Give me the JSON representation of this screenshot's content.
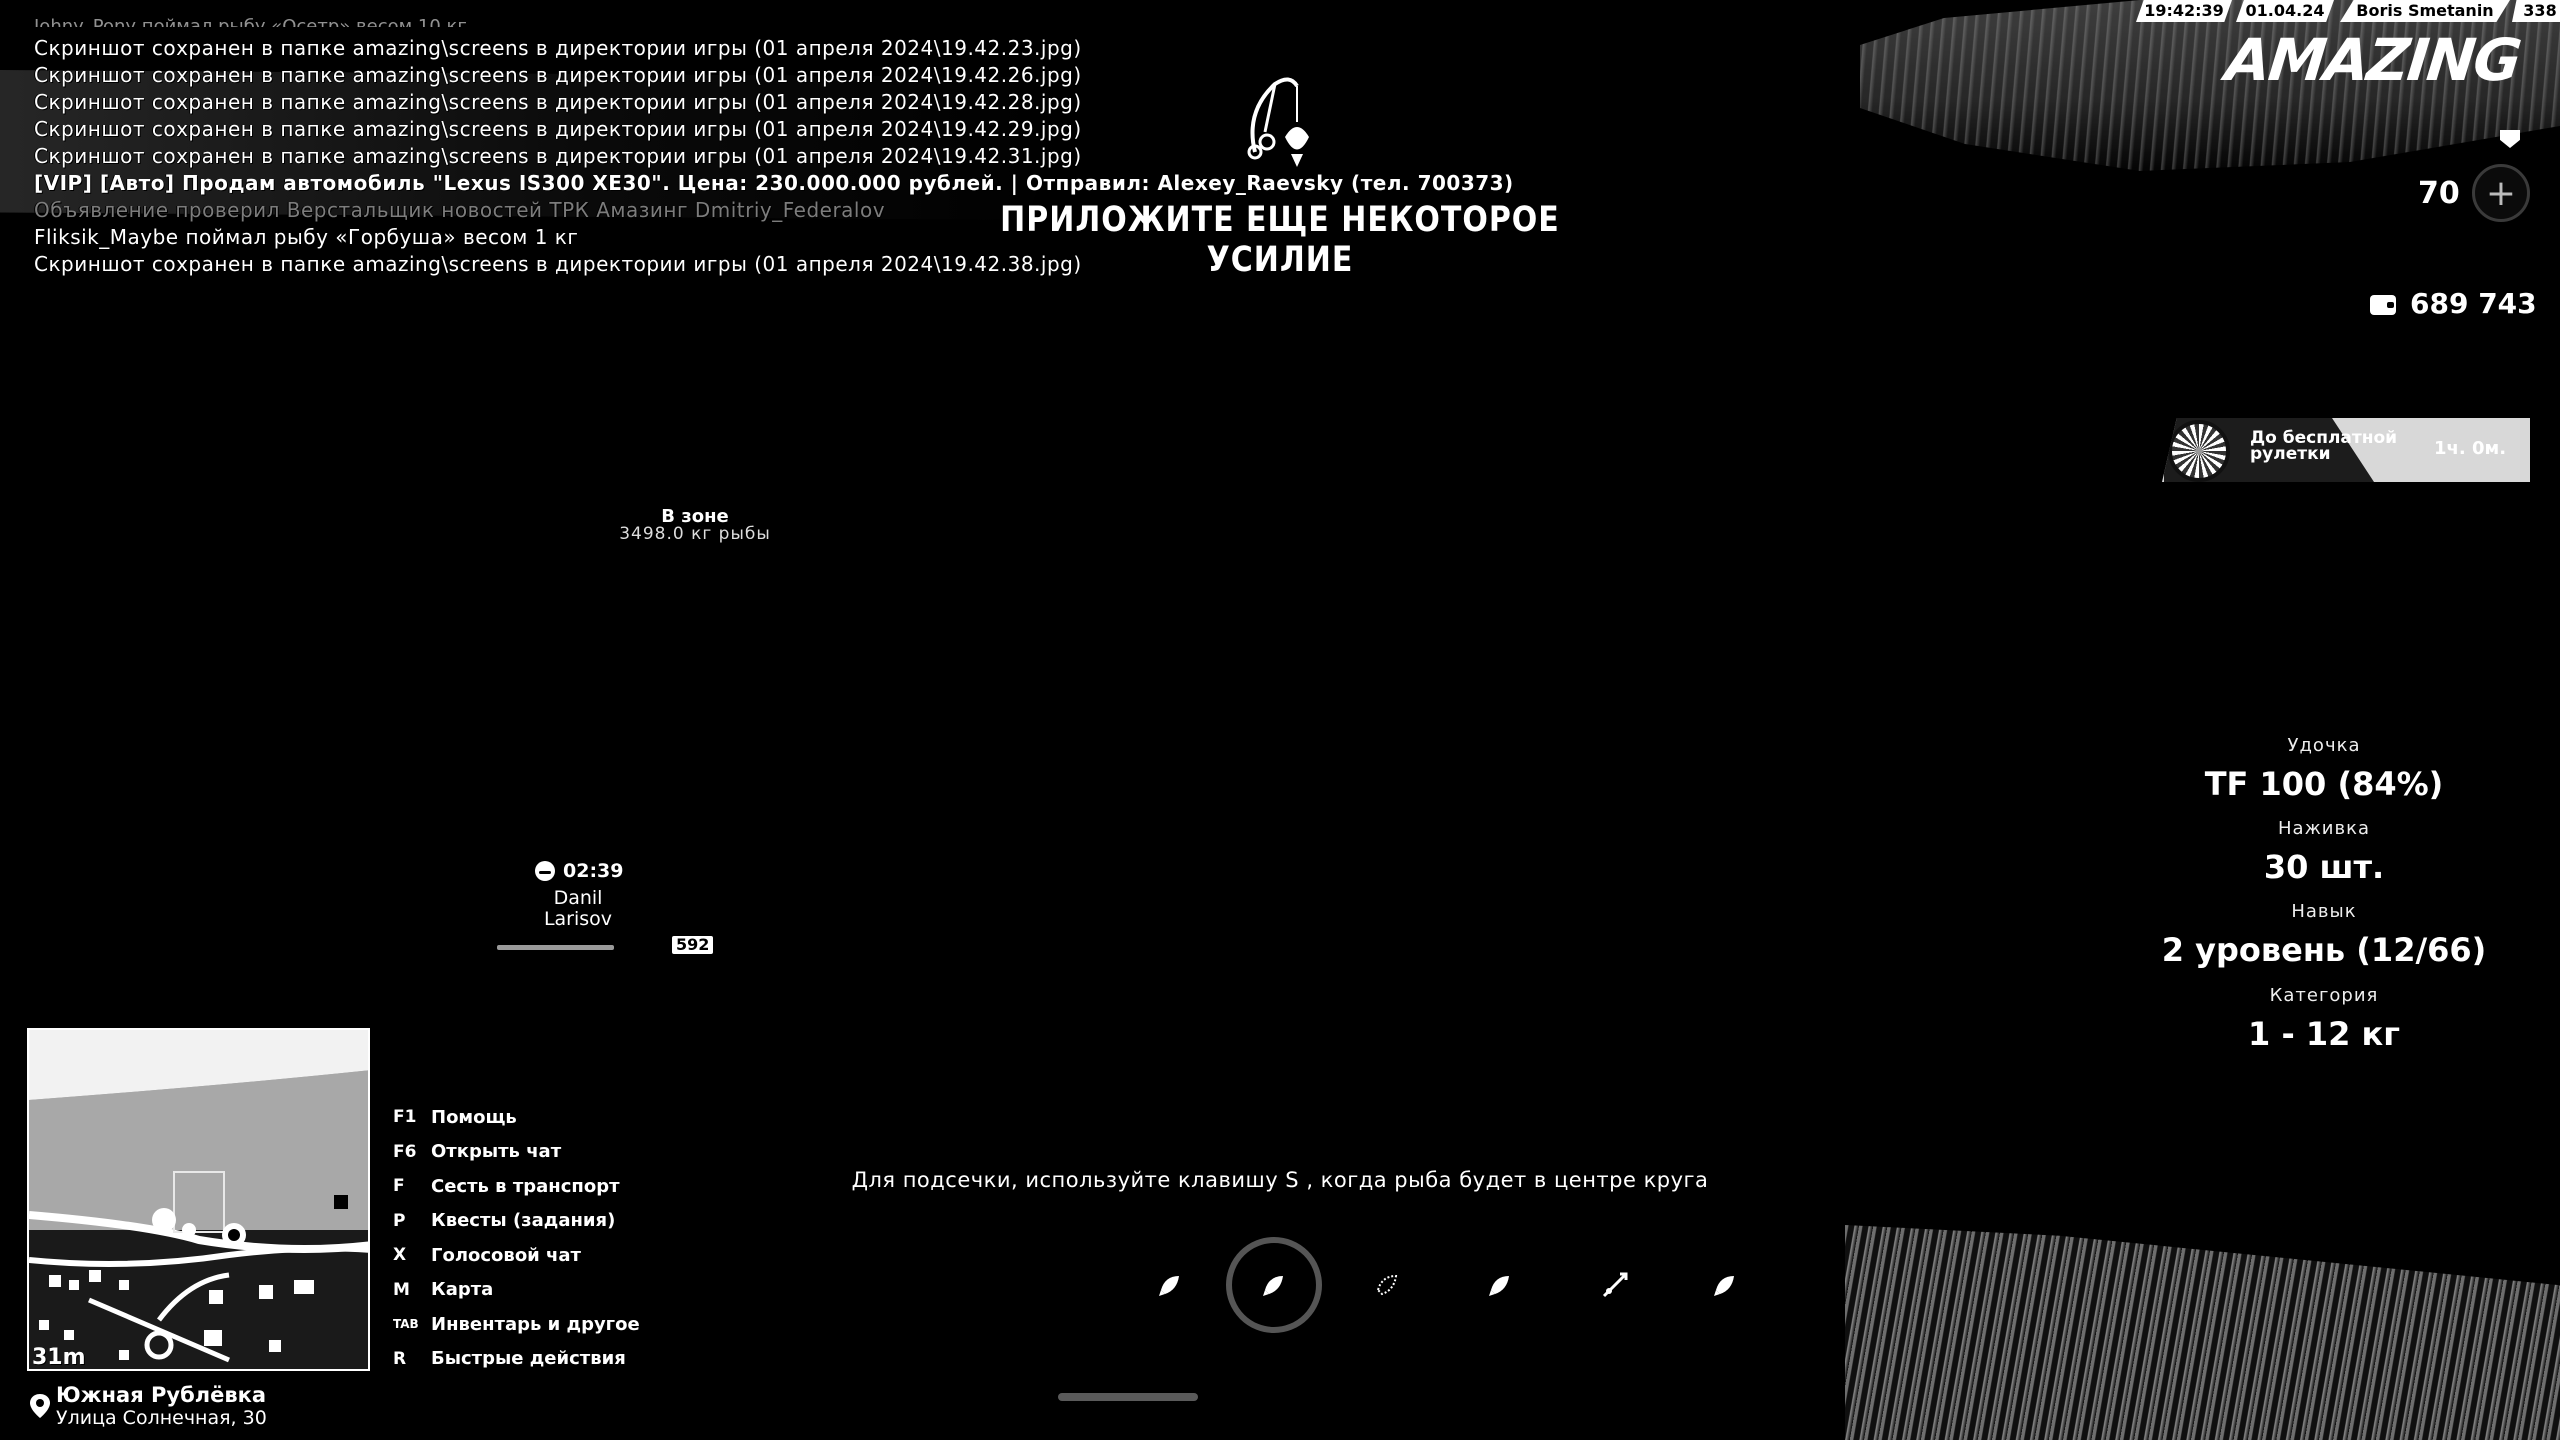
{
  "status_bar": {
    "time": "19:42:39",
    "date": "01.04.24",
    "player": "Boris Smetanin",
    "id": "338"
  },
  "logo": "AMAZING",
  "chat": {
    "cutoff_line": "Johny_Pony поймал рыбу «Осетр» весом 10 кг",
    "lines": [
      {
        "text": "Скриншот сохранен в папке amazing\\screens в директории игры (01 апреля 2024\\19.42.23.jpg)",
        "style": "normal"
      },
      {
        "text": "Скриншот сохранен в папке amazing\\screens в директории игры (01 апреля 2024\\19.42.26.jpg)",
        "style": "normal"
      },
      {
        "text": "Скриншот сохранен в папке amazing\\screens в директории игры (01 апреля 2024\\19.42.28.jpg)",
        "style": "normal"
      },
      {
        "text": "Скриншот сохранен в папке amazing\\screens в директории игры (01 апреля 2024\\19.42.29.jpg)",
        "style": "normal"
      },
      {
        "text": "Скриншот сохранен в папке amazing\\screens в директории игры (01 апреля 2024\\19.42.31.jpg)",
        "style": "normal"
      },
      {
        "text": "[VIP] [Авто] Продам автомобиль \"Lexus IS300 XE30\". Цена: 230.000.000 рублей. | Отправил: Alexey_Raevsky (тел. 700373)",
        "style": "bold"
      },
      {
        "text": "Объявление проверил Верстальщик новостей ТРК Амазинг Dmitriy_Federalov",
        "style": "faded"
      },
      {
        "text": "Fliksik_Maybe поймал рыбу «Горбуша» весом 1 кг",
        "style": "normal"
      },
      {
        "text": "Скриншот сохранен в папке amazing\\screens в директории игры (01 апреля 2024\\19.42.38.jpg)",
        "style": "normal"
      }
    ]
  },
  "center": {
    "effort_text": "ПРИЛОЖИТЕ ЕЩЕ НЕКОТОРОЕ УСИЛИЕ",
    "hint": "Для подсечки, используйте клавишу S , когда рыба будет в центре круга"
  },
  "zone": {
    "title": "В зоне",
    "subtitle": "3498.0 кг рыбы"
  },
  "player_marker": {
    "time": "02:39",
    "name": "Danil Larisov",
    "id": "592"
  },
  "hud": {
    "level": "70",
    "money": "689 743"
  },
  "roulette": {
    "label": "До бесплатной рулетки",
    "timer": "1ч. 0м."
  },
  "fishing": {
    "rod_label": "Удочка",
    "rod_value": "TF 100 (84%)",
    "bait_label": "Наживка",
    "bait_value": "30 шт.",
    "skill_label": "Навык",
    "skill_value": "2 уровень (12/66)",
    "category_label": "Категория",
    "category_value": "1 - 12 кг"
  },
  "minimap": {
    "scale": "31m",
    "street1": "Южная Рублёвка",
    "street2": "Улица Солнечная, 30"
  },
  "keybinds": [
    {
      "key": "F1",
      "label": "Помощь"
    },
    {
      "key": "F6",
      "label": "Открыть чат"
    },
    {
      "key": "F",
      "label": "Сесть в транспорт"
    },
    {
      "key": "P",
      "label": "Квесты (задания)"
    },
    {
      "key": "X",
      "label": "Голосовой чат"
    },
    {
      "key": "M",
      "label": "Карта"
    },
    {
      "key": "TAB",
      "label": "Инвентарь и другое"
    },
    {
      "key": "R",
      "label": "Быстрые действия"
    }
  ],
  "hotbar": [
    {
      "icon": "fish-icon"
    },
    {
      "icon": "fish-icon",
      "active": true
    },
    {
      "icon": "fish-icon"
    },
    {
      "icon": "fish-icon"
    },
    {
      "icon": "fishing-rod-icon"
    },
    {
      "icon": "fish-icon"
    }
  ]
}
